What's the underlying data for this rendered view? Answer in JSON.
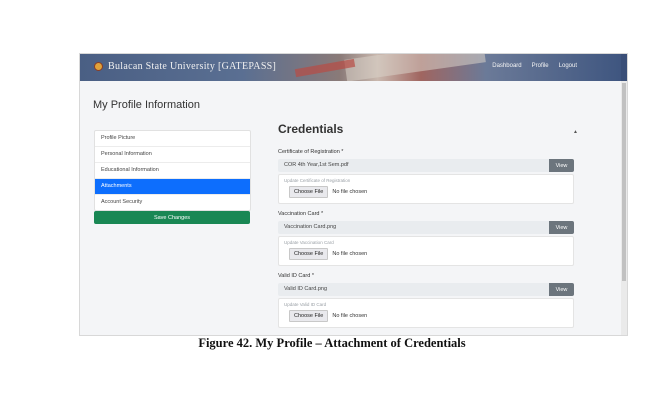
{
  "navbar": {
    "brand": "Bulacan State University [GATEPASS]",
    "links": [
      "Dashboard",
      "Profile",
      "Logout"
    ]
  },
  "page": {
    "title": "My Profile Information"
  },
  "sidebar": {
    "items": [
      {
        "label": "Profile Picture",
        "active": false
      },
      {
        "label": "Personal Information",
        "active": false
      },
      {
        "label": "Educational Information",
        "active": false
      },
      {
        "label": "Attachments",
        "active": true
      },
      {
        "label": "Account Security",
        "active": false
      }
    ],
    "save_label": "Save Changes"
  },
  "credentials": {
    "title": "Credentials",
    "fields": [
      {
        "label": "Certificate of Registration",
        "required_mark": "*",
        "file_name": "COR 4th Year,1st Sem.pdf",
        "view_label": "View",
        "upload_label": "Update Certificate of Registration",
        "choose_label": "Choose File",
        "no_file_text": "No file chosen"
      },
      {
        "label": "Vaccination Card",
        "required_mark": "*",
        "file_name": "Vaccination Card.png",
        "view_label": "View",
        "upload_label": "Update Vaccination Card",
        "choose_label": "Choose File",
        "no_file_text": "No file chosen"
      },
      {
        "label": "Valid ID Card",
        "required_mark": "*",
        "file_name": "Valid ID Card.png",
        "view_label": "View",
        "upload_label": "Update Valid ID Card",
        "choose_label": "Choose File",
        "no_file_text": "No file chosen"
      }
    ]
  },
  "caption": "Figure 42. My Profile – Attachment of Credentials",
  "colors": {
    "active": "#0d6efd",
    "save": "#198754",
    "view": "#6c757d"
  }
}
